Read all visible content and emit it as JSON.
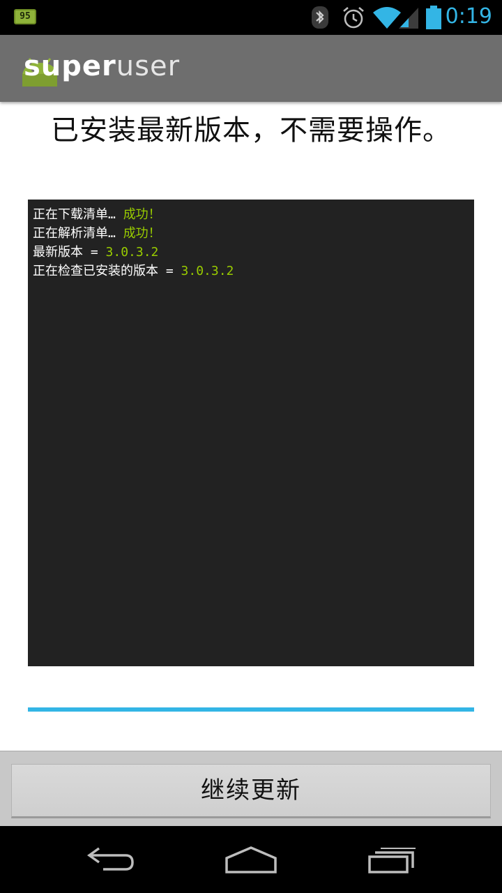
{
  "status_bar": {
    "notification_badge": "95",
    "time": "0:19",
    "icons": [
      "bluetooth-icon",
      "alarm-icon",
      "wifi-icon",
      "signal-icon",
      "battery-icon"
    ],
    "accent_color": "#33b5e5"
  },
  "action_bar": {
    "title_bold": "super",
    "title_light": "user",
    "icon": "android-icon"
  },
  "heading": "已安装最新版本，不需要操作。",
  "console": {
    "lines": [
      {
        "text": "正在下载清单… ",
        "status": "成功！"
      },
      {
        "text": "正在解析清单… ",
        "status": "成功！"
      },
      {
        "text": "最新版本 = ",
        "status": "3.0.3.2"
      },
      {
        "text": "正在检查已安装的版本 = ",
        "status": "3.0.3.2"
      }
    ],
    "status_color": "#99cc00"
  },
  "progress": {
    "fraction": 1.0
  },
  "button": {
    "label": "继续更新"
  },
  "nav_bar": {
    "icons": [
      "back-icon",
      "home-icon",
      "recent-apps-icon"
    ]
  }
}
